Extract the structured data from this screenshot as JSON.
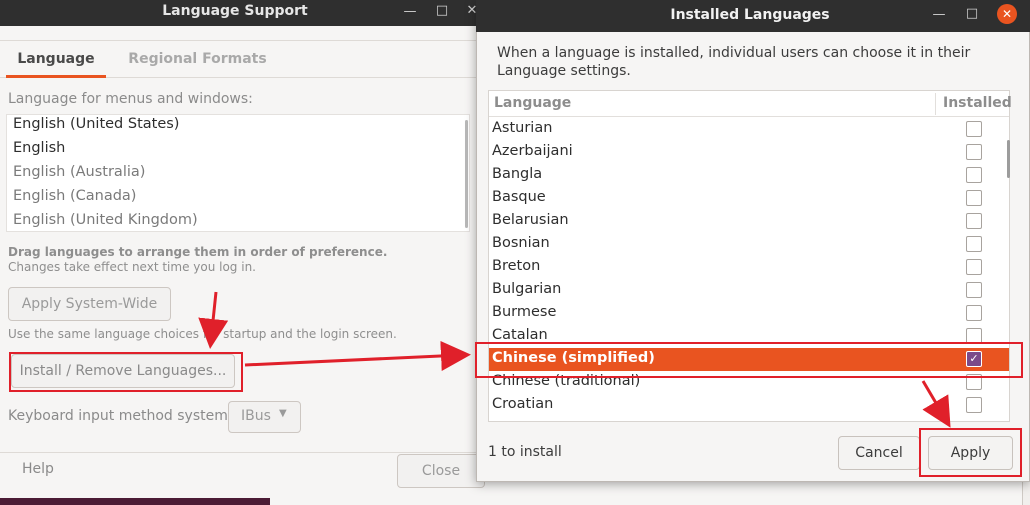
{
  "back_window": {
    "title": "Language Support",
    "tabs": [
      "Language",
      "Regional Formats"
    ],
    "languages_label": "Language for menus and windows:",
    "languages": [
      "English (United States)",
      "English",
      "English (Australia)",
      "English (Canada)",
      "English (United Kingdom)"
    ],
    "drag_hint": "Drag languages to arrange them in order of preference.",
    "changes_hint": "Changes take effect next time you log in.",
    "apply_system_wide": "Apply System-Wide",
    "same_choice_hint": "Use the same language choices for startup and the login screen.",
    "install_remove": "Install / Remove Languages...",
    "keyboard_label": "Keyboard input method system:",
    "keyboard_value": "IBus",
    "help": "Help",
    "close": "Close"
  },
  "dialog": {
    "title": "Installed Languages",
    "description": "When a language is installed, individual users can choose it in their Language settings.",
    "columns": [
      "Language",
      "Installed"
    ],
    "rows": [
      {
        "name": "Asturian",
        "installed": false
      },
      {
        "name": "Azerbaijani",
        "installed": false
      },
      {
        "name": "Bangla",
        "installed": false
      },
      {
        "name": "Basque",
        "installed": false
      },
      {
        "name": "Belarusian",
        "installed": false
      },
      {
        "name": "Bosnian",
        "installed": false
      },
      {
        "name": "Breton",
        "installed": false
      },
      {
        "name": "Bulgarian",
        "installed": false
      },
      {
        "name": "Burmese",
        "installed": false
      },
      {
        "name": "Catalan",
        "installed": false
      },
      {
        "name": "Chinese (simplified)",
        "installed": true,
        "selected": true
      },
      {
        "name": "Chinese (traditional)",
        "installed": false
      },
      {
        "name": "Croatian",
        "installed": false
      }
    ],
    "status": "1 to install",
    "cancel": "Cancel",
    "apply": "Apply"
  },
  "colors": {
    "accent": "#e95420",
    "annotation_red": "#e0202a",
    "titlebar": "#2f2f2f"
  }
}
